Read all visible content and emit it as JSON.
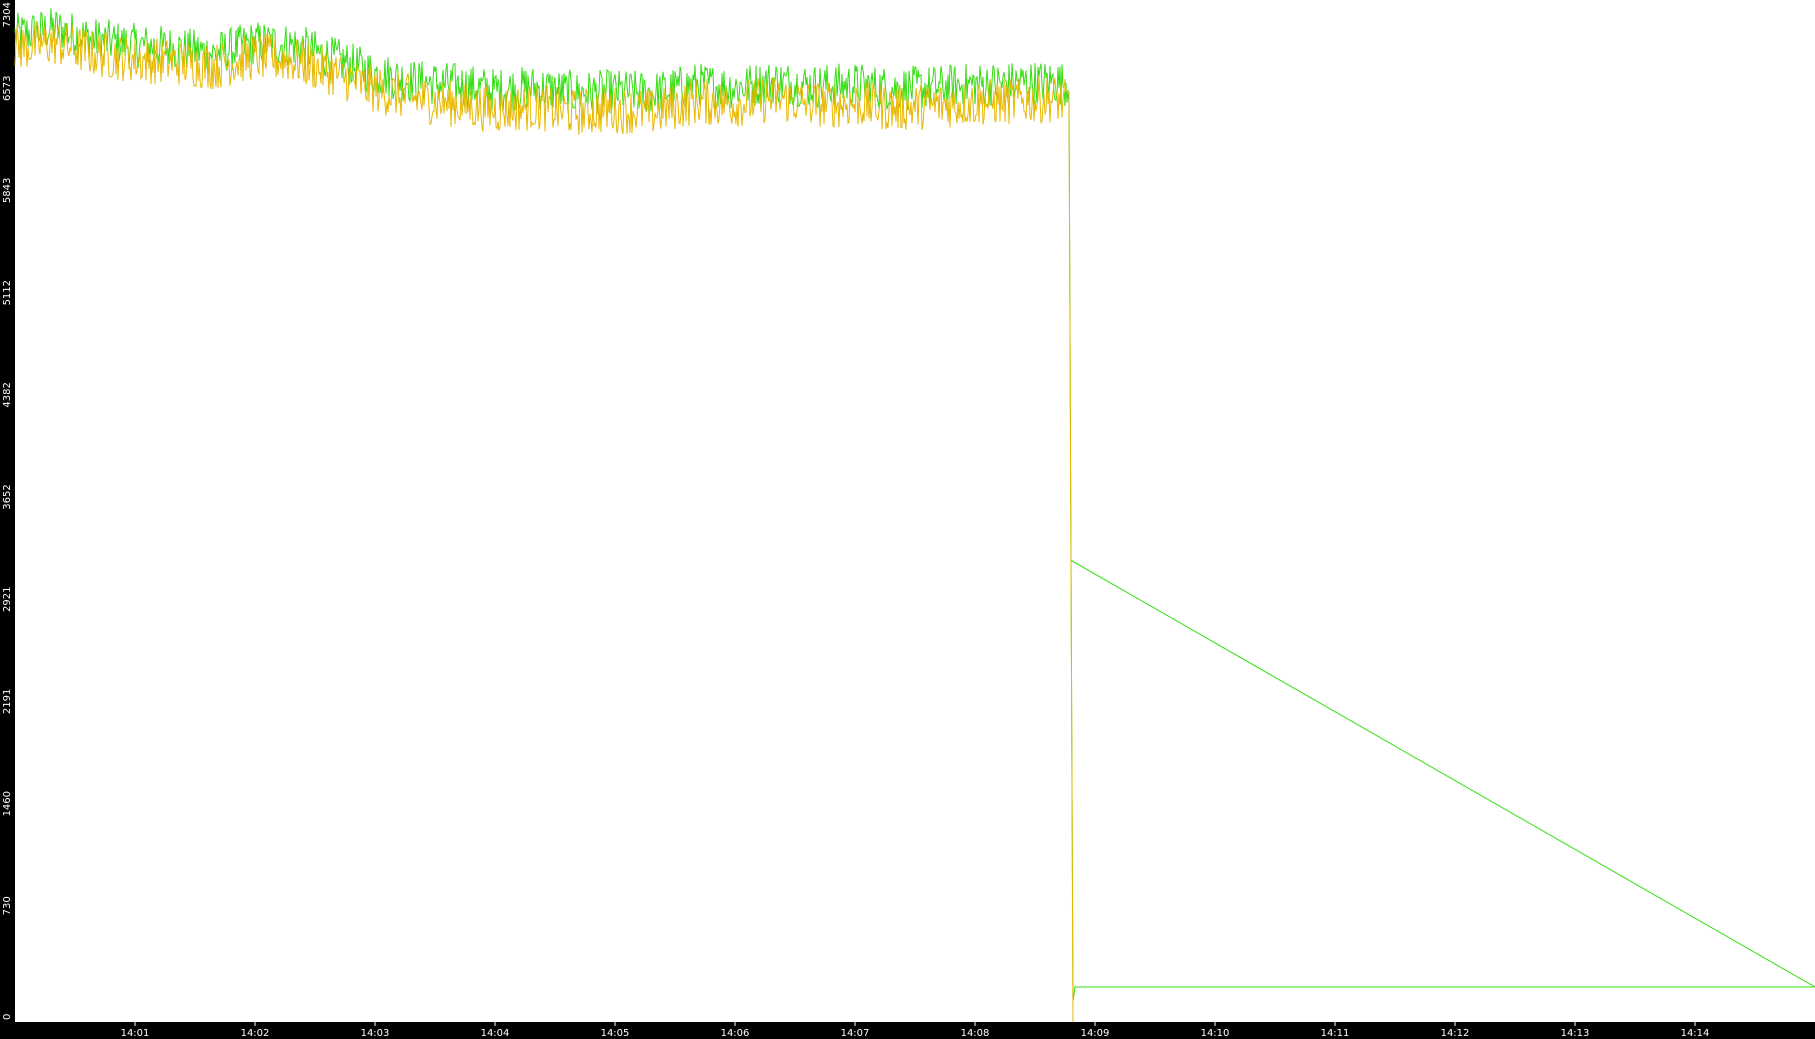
{
  "chart_data": {
    "type": "line",
    "background_color": "#ffffff",
    "axis_color": "#000000",
    "tick_label_color": "#ffffff",
    "grid": false,
    "legend": "none",
    "ylim": [
      0,
      7304
    ],
    "y_ticks": [
      {
        "value": 0,
        "label": "0"
      },
      {
        "value": 730,
        "label": "730"
      },
      {
        "value": 1460,
        "label": "1460"
      },
      {
        "value": 2191,
        "label": "2191"
      },
      {
        "value": 2921,
        "label": "2921"
      },
      {
        "value": 3652,
        "label": "3652"
      },
      {
        "value": 4382,
        "label": "4382"
      },
      {
        "value": 5112,
        "label": "5112"
      },
      {
        "value": 5843,
        "label": "5843"
      },
      {
        "value": 6573,
        "label": "6573"
      },
      {
        "value": 7304,
        "label": "7304"
      }
    ],
    "xlim": [
      "14:00:00",
      "14:15:00"
    ],
    "x_ticks": [
      {
        "value": "14:01:00",
        "label": "14:01"
      },
      {
        "value": "14:02:00",
        "label": "14:02"
      },
      {
        "value": "14:03:00",
        "label": "14:03"
      },
      {
        "value": "14:04:00",
        "label": "14:04"
      },
      {
        "value": "14:05:00",
        "label": "14:05"
      },
      {
        "value": "14:06:00",
        "label": "14:06"
      },
      {
        "value": "14:07:00",
        "label": "14:07"
      },
      {
        "value": "14:08:00",
        "label": "14:08"
      },
      {
        "value": "14:09:00",
        "label": "14:09"
      },
      {
        "value": "14:10:00",
        "label": "14:10"
      },
      {
        "value": "14:11:00",
        "label": "14:11"
      },
      {
        "value": "14:12:00",
        "label": "14:12"
      },
      {
        "value": "14:13:00",
        "label": "14:13"
      },
      {
        "value": "14:14:00",
        "label": "14:14"
      }
    ],
    "series": [
      {
        "color": "#33dd11",
        "x": [
          "14:00:00",
          "14:00:20",
          "14:00:40",
          "14:01:00",
          "14:01:20",
          "14:01:40",
          "14:02:00",
          "14:02:20",
          "14:02:40",
          "14:03:00",
          "14:03:20",
          "14:03:40",
          "14:04:00",
          "14:04:20",
          "14:04:40",
          "14:05:00",
          "14:05:20",
          "14:05:40",
          "14:06:00",
          "14:06:20",
          "14:06:40",
          "14:07:00",
          "14:07:20",
          "14:07:40",
          "14:08:00",
          "14:08:20",
          "14:08:40",
          "14:08:47",
          "14:08:48",
          "14:08:49",
          "14:08:50",
          "14:09:30",
          "14:10:30",
          "14:11:30",
          "14:12:30",
          "14:13:30",
          "14:14:30",
          "14:15:00"
        ],
        "y": [
          7050,
          7100,
          7020,
          6980,
          6960,
          6920,
          7000,
          6980,
          6880,
          6780,
          6720,
          6700,
          6660,
          6680,
          6640,
          6650,
          6640,
          6700,
          6680,
          6720,
          6690,
          6700,
          6670,
          6680,
          6700,
          6710,
          6720,
          6700,
          3300,
          150,
          250,
          250,
          250,
          250,
          250,
          250,
          250,
          250
        ],
        "noise": 160
      },
      {
        "color": "#e8b800",
        "x": [
          "14:00:00",
          "14:00:20",
          "14:00:40",
          "14:01:00",
          "14:01:20",
          "14:01:40",
          "14:02:00",
          "14:02:20",
          "14:02:40",
          "14:03:00",
          "14:03:20",
          "14:03:40",
          "14:04:00",
          "14:04:20",
          "14:04:40",
          "14:05:00",
          "14:05:20",
          "14:05:40",
          "14:06:00",
          "14:06:20",
          "14:06:40",
          "14:07:00",
          "14:07:20",
          "14:07:40",
          "14:08:00",
          "14:08:20",
          "14:08:40",
          "14:08:47",
          "14:08:49"
        ],
        "y": [
          6960,
          7000,
          6920,
          6880,
          6860,
          6830,
          6900,
          6870,
          6780,
          6660,
          6600,
          6560,
          6520,
          6540,
          6500,
          6520,
          6500,
          6580,
          6560,
          6600,
          6560,
          6560,
          6530,
          6550,
          6570,
          6580,
          6600,
          6560,
          0
        ],
        "noise": 170
      }
    ]
  }
}
